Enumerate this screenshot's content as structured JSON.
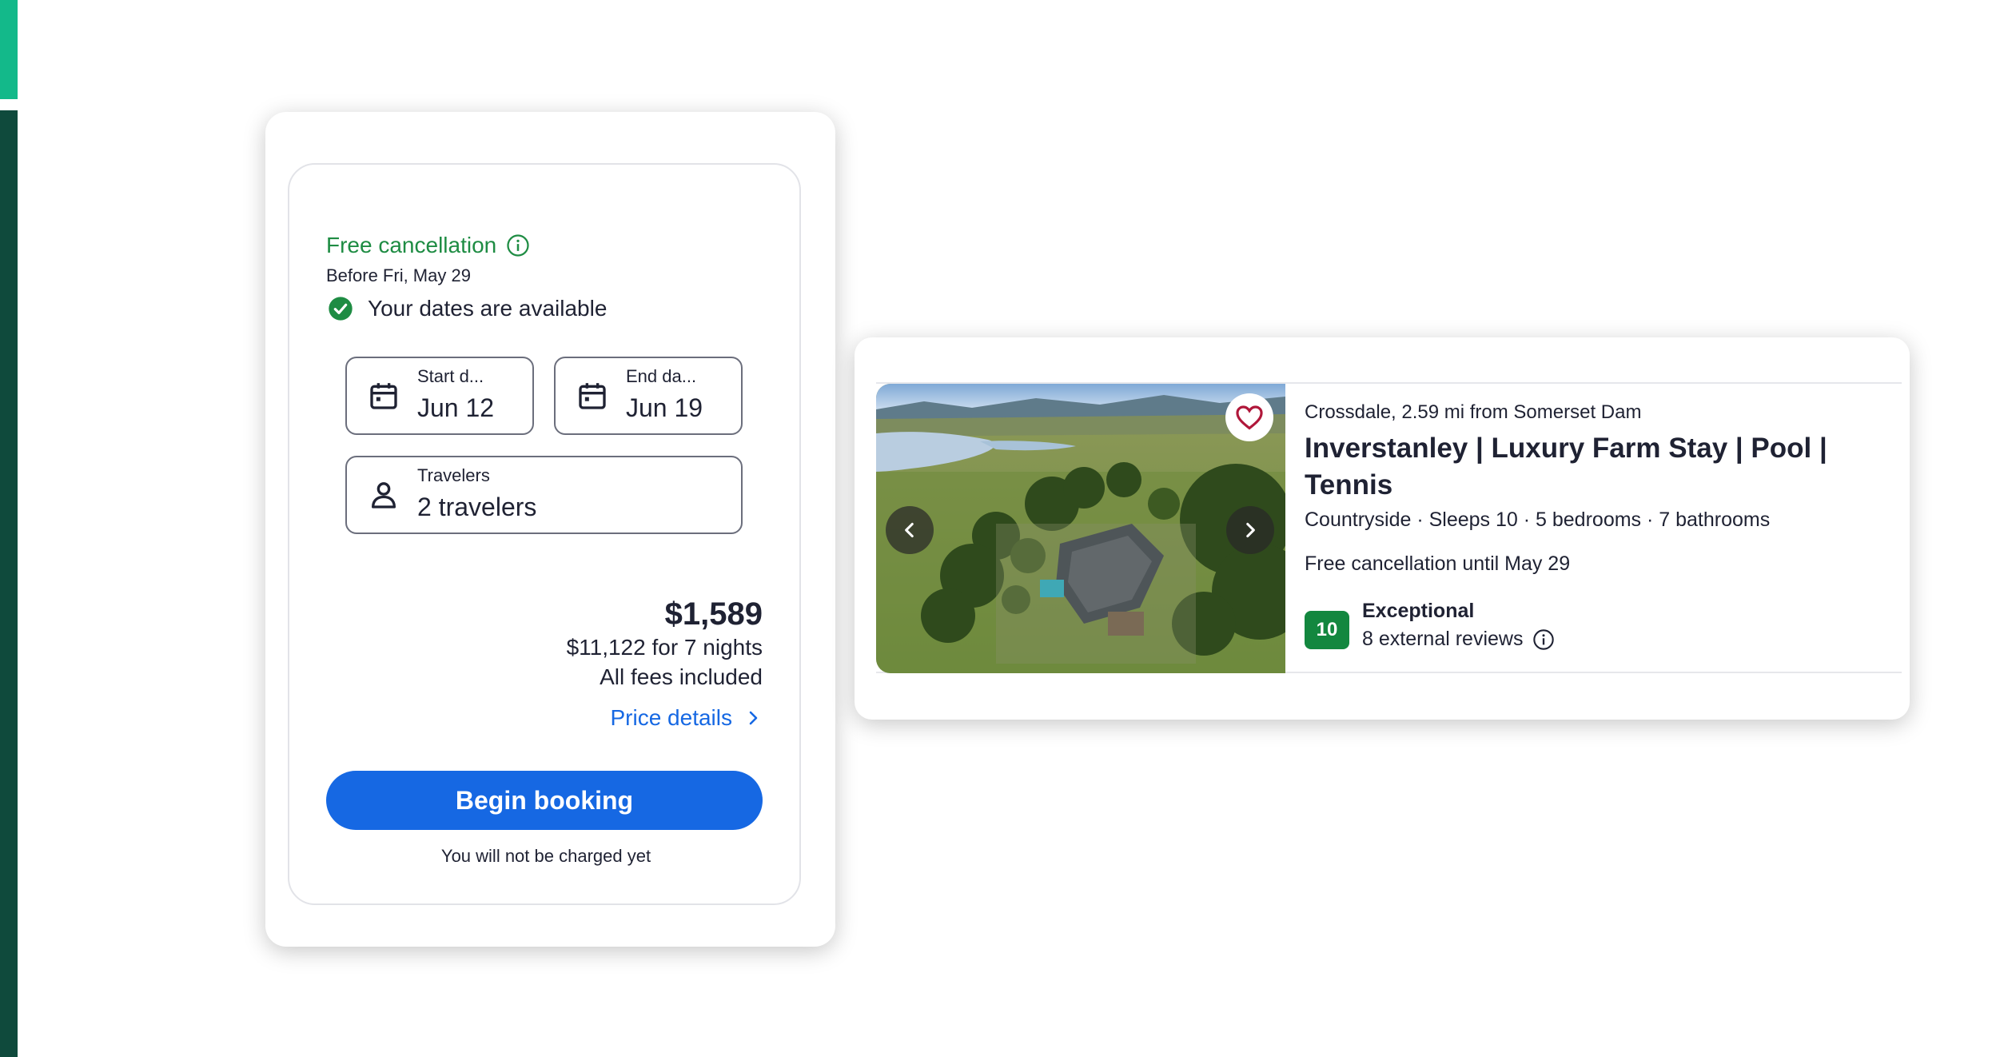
{
  "booking": {
    "free_cancellation": "Free cancellation",
    "cancel_before": "Before Fri, May 29",
    "availability": "Your dates are available",
    "start_label": "Start d...",
    "start_value": "Jun 12",
    "end_label": "End da...",
    "end_value": "Jun 19",
    "travelers_label": "Travelers",
    "travelers_value": "2 travelers",
    "price": "$1,589",
    "total": "$11,122 for 7 nights",
    "fees": "All fees included",
    "price_details": "Price details",
    "begin_button": "Begin booking",
    "not_charged": "You will not be charged yet"
  },
  "property": {
    "location": "Crossdale, 2.59 mi from Somerset Dam",
    "title": "Inverstanley | Luxury Farm Stay | Pool | Tennis",
    "meta": "Countryside · Sleeps 10 · 5 bedrooms · 7 bathrooms",
    "cancellation": "Free cancellation until May 29",
    "score": "10",
    "rating_label": "Exceptional",
    "reviews": "8 external reviews"
  },
  "icons": {
    "info": "info-icon",
    "check": "check-circle-icon",
    "calendar": "calendar-icon",
    "person": "person-icon",
    "chevron": "chevron-right-icon",
    "heart": "heart-icon",
    "prev": "chevron-left-icon",
    "next": "chevron-right-icon"
  },
  "colors": {
    "accent_green": "#13b98a",
    "dark_green": "#0f4a3c",
    "success": "#1e8c43",
    "primary": "#1668e3",
    "score_badge": "#13873f"
  }
}
